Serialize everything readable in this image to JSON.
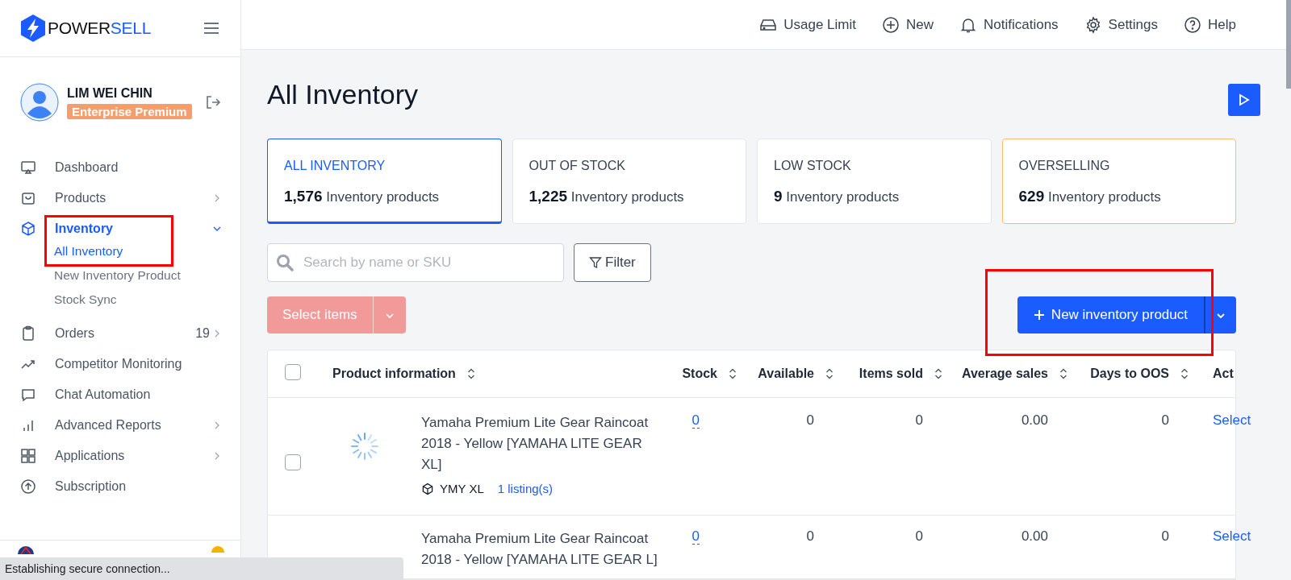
{
  "brand": {
    "name_a": "POWER",
    "name_b": "SELL"
  },
  "header": {
    "actions": [
      {
        "kind": "usage",
        "label": "Usage Limit"
      },
      {
        "kind": "new",
        "label": "New"
      },
      {
        "kind": "bell",
        "label": "Notifications"
      },
      {
        "kind": "gear",
        "label": "Settings"
      },
      {
        "kind": "help",
        "label": "Help"
      }
    ]
  },
  "user": {
    "name": "LIM WEI CHIN",
    "plan": "Enterprise Premium"
  },
  "sidebar": {
    "items": [
      {
        "kind": "monitor",
        "label": "Dashboard",
        "selected": false,
        "expandable": false,
        "expanded": false,
        "highlighted": false
      },
      {
        "kind": "bag",
        "label": "Products",
        "selected": false,
        "expandable": true,
        "expanded": false,
        "highlighted": false
      },
      {
        "kind": "cube",
        "label": "Inventory",
        "selected": true,
        "expandable": true,
        "expanded": true,
        "highlighted": true,
        "children": [
          {
            "label": "All Inventory",
            "selected": true
          },
          {
            "label": "New Inventory Product",
            "selected": false
          },
          {
            "label": "Stock Sync",
            "selected": false
          }
        ]
      },
      {
        "kind": "clipboard",
        "label": "Orders",
        "selected": false,
        "expandable": true,
        "expanded": false,
        "highlighted": false,
        "count": "19"
      },
      {
        "kind": "trend",
        "label": "Competitor Monitoring",
        "selected": false,
        "expandable": false,
        "expanded": false,
        "highlighted": false
      },
      {
        "kind": "chat",
        "label": "Chat Automation",
        "selected": false,
        "expandable": false,
        "expanded": false,
        "highlighted": false
      },
      {
        "kind": "bars",
        "label": "Advanced Reports",
        "selected": false,
        "expandable": true,
        "expanded": false,
        "highlighted": false
      },
      {
        "kind": "grid",
        "label": "Applications",
        "selected": false,
        "expandable": true,
        "expanded": false,
        "highlighted": false
      },
      {
        "kind": "upload",
        "label": "Subscription",
        "selected": false,
        "expandable": false,
        "expanded": false,
        "highlighted": false
      }
    ]
  },
  "page_title": "All Inventory",
  "summary_tabs": [
    {
      "label": "ALL INVENTORY",
      "count": "1,576",
      "unit": "Inventory products",
      "selected": true,
      "warning": false
    },
    {
      "label": "OUT OF STOCK",
      "count": "1,225",
      "unit": "Inventory products",
      "selected": false,
      "warning": false
    },
    {
      "label": "LOW STOCK",
      "count": "9",
      "unit": "Inventory products",
      "selected": false,
      "warning": false
    },
    {
      "label": "OVERSELLING",
      "count": "629",
      "unit": "Inventory products",
      "selected": false,
      "warning": true
    }
  ],
  "search": {
    "placeholder": "Search by name or SKU"
  },
  "filter_button": "Filter",
  "select_items_button": {
    "label": "Select items",
    "disabled": true
  },
  "new_product_button": {
    "label": "New inventory product",
    "highlighted": true
  },
  "table": {
    "all_checked": false,
    "columns": [
      "Product information",
      "Stock",
      "Available",
      "Items sold",
      "Average sales",
      "Days to OOS",
      "Act"
    ],
    "rows": [
      {
        "name": "Yamaha Premium Lite Gear Raincoat 2018 - Yellow [YAMAHA LITE GEAR XL]",
        "sku": "YMY XL",
        "listings": "1 listing(s)",
        "stock": "0",
        "available": "0",
        "items_sold": "0",
        "average_sales": "0.00",
        "days_to_oos": "0",
        "action": "Select",
        "checked": false
      },
      {
        "name": "Yamaha Premium Lite Gear Raincoat 2018 - Yellow [YAMAHA LITE GEAR L]",
        "stock": "0",
        "available": "0",
        "items_sold": "0",
        "average_sales": "0.00",
        "days_to_oos": "0",
        "action": "Select"
      }
    ]
  },
  "status_bar": "Establishing secure connection..."
}
